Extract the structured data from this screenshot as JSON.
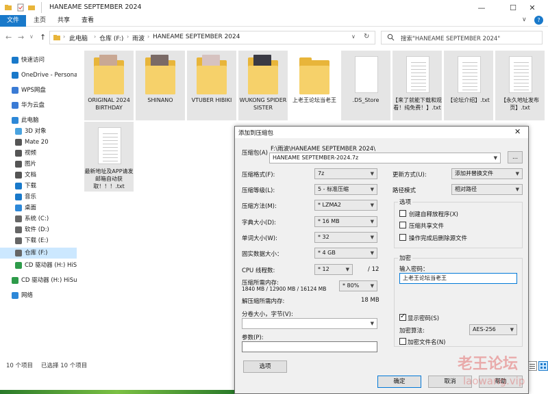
{
  "window": {
    "title": "HANEAME SEPTEMBER 2024"
  },
  "window_controls": {
    "minimize": "—",
    "maximize": "☐",
    "close": "✕",
    "help": "?"
  },
  "ribbon": {
    "tabs": [
      "文件",
      "主页",
      "共享",
      "查看"
    ]
  },
  "nav": {
    "back": "←",
    "forward": "→",
    "recent": "∨",
    "up": "↑",
    "dropdown": "∨",
    "refresh": "↻"
  },
  "address": {
    "crumbs": [
      "此电脑",
      "仓库 (F:)",
      "雨波",
      "HANEAME SEPTEMBER 2024"
    ],
    "separator": "›"
  },
  "search": {
    "placeholder": "搜索\"HANEAME SEPTEMBER 2024\""
  },
  "sidebar": {
    "items": [
      {
        "label": "快速访问",
        "icon": "star-icon",
        "color": "#1979ca"
      },
      {
        "label": "OneDrive - Personal",
        "icon": "cloud-icon",
        "color": "#1979ca"
      },
      {
        "label": "WPS网盘",
        "icon": "cloud-icon",
        "color": "#3a7bd5"
      },
      {
        "label": "华为云盘",
        "icon": "cloud-icon",
        "color": "#3a7bd5"
      },
      {
        "label": "此电脑",
        "icon": "computer-icon",
        "color": "#2d88d8"
      },
      {
        "label": "3D 对象",
        "icon": "cube-icon",
        "color": "#4aa3df"
      },
      {
        "label": "Mate 20",
        "icon": "phone-icon",
        "color": "#555555"
      },
      {
        "label": "视频",
        "icon": "video-icon",
        "color": "#555555"
      },
      {
        "label": "图片",
        "icon": "picture-icon",
        "color": "#555555"
      },
      {
        "label": "文档",
        "icon": "document-icon",
        "color": "#555555"
      },
      {
        "label": "下载",
        "icon": "download-icon",
        "color": "#1979ca"
      },
      {
        "label": "音乐",
        "icon": "music-icon",
        "color": "#1979ca"
      },
      {
        "label": "桌面",
        "icon": "desktop-icon",
        "color": "#2d88d8"
      },
      {
        "label": "系统 (C:)",
        "icon": "drive-icon",
        "color": "#666666"
      },
      {
        "label": "软件 (D:)",
        "icon": "drive-icon",
        "color": "#666666"
      },
      {
        "label": "下载 (E:)",
        "icon": "drive-icon",
        "color": "#666666"
      },
      {
        "label": "仓库 (F:)",
        "icon": "drive-icon",
        "color": "#666666"
      },
      {
        "label": "CD 驱动器 (H:) HiSu",
        "icon": "cd-drive-icon",
        "color": "#2e9b4a"
      },
      {
        "label": "CD 驱动器 (H:) HiSuit",
        "icon": "cd-drive-icon",
        "color": "#2e9b4a"
      },
      {
        "label": "网络",
        "icon": "network-icon",
        "color": "#2d88d8"
      }
    ],
    "selected_index": 16
  },
  "files": [
    {
      "name": "ORIGINAL 2024 BIRTHDAY",
      "kind": "folder",
      "photo": "#c9a894"
    },
    {
      "name": "SHINANO",
      "kind": "folder",
      "photo": "#7a6a66"
    },
    {
      "name": "VTUBER HIBIKI",
      "kind": "folder",
      "photo": "#d6c2c0"
    },
    {
      "name": "WUKONG SPIDER SISTER",
      "kind": "folder",
      "photo": "#3a3a44"
    },
    {
      "name": "上老王论坛当老王",
      "kind": "folder",
      "photo": ""
    },
    {
      "name": ".DS_Store",
      "kind": "file"
    },
    {
      "name": "【来了就能下载和观看！纯免费！】.txt",
      "kind": "txt"
    },
    {
      "name": "【论坛介绍】.txt",
      "kind": "txt"
    },
    {
      "name": "【永久地址发布页】.txt",
      "kind": "txt"
    },
    {
      "name": "最新地址及APP请发邮箱自动获取！！！.txt",
      "kind": "txt"
    }
  ],
  "status": {
    "count": "10 个项目",
    "selected": "已选择 10 个项目"
  },
  "dialog": {
    "title": "添加到压缩包",
    "archive_label": "压缩包(A)",
    "archive_path": "F:\\雨波\\HANEAME SEPTEMBER 2024\\",
    "archive_name": "HANEAME SEPTEMBER-2024.7z",
    "browse_label": "...",
    "format_label": "压缩格式(F):",
    "format_value": "7z",
    "level_label": "压缩等级(L):",
    "level_value": "5 - 标准压缩",
    "method_label": "压缩方法(M):",
    "method_value": "* LZMA2",
    "dict_label": "字典大小(D):",
    "dict_value": "* 16 MB",
    "word_label": "单词大小(W):",
    "word_value": "* 32",
    "solid_label": "固实数据大小：",
    "solid_value": "* 4 GB",
    "threads_label": "CPU 线程数:",
    "threads_value": "* 12",
    "threads_total": "/ 12",
    "mem_comp_label": "压缩所需内存:",
    "mem_comp_value": "1840 MB / 12900 MB / 16124 MB",
    "mem_percent": "* 80%",
    "mem_decomp_label": "解压缩所需内存:",
    "mem_decomp_value": "18 MB",
    "split_label": "分卷大小，字节(V):",
    "split_value": "",
    "params_label": "参数(P):",
    "params_value": "",
    "options_button": "选项",
    "update_label": "更新方式(U):",
    "update_value": "添加并替换文件",
    "path_label": "路径模式",
    "path_value": "相对路径",
    "options_group": "选项",
    "opt_sfx": "创建自释放程序(X)",
    "opt_shared": "压缩共享文件",
    "opt_delete": "操作完成后删除源文件",
    "encryption_group": "加密",
    "password_label": "输入密码：",
    "password_value": "上老王论坛当老王",
    "show_password": "显示密码(S)",
    "enc_method_label": "加密算法:",
    "enc_method_value": "AES-256",
    "encrypt_names": "加密文件名(N)",
    "ok": "确定",
    "cancel": "取消",
    "help": "帮助"
  },
  "watermark": {
    "text": "老王论坛",
    "sub": "laowang.vip"
  }
}
